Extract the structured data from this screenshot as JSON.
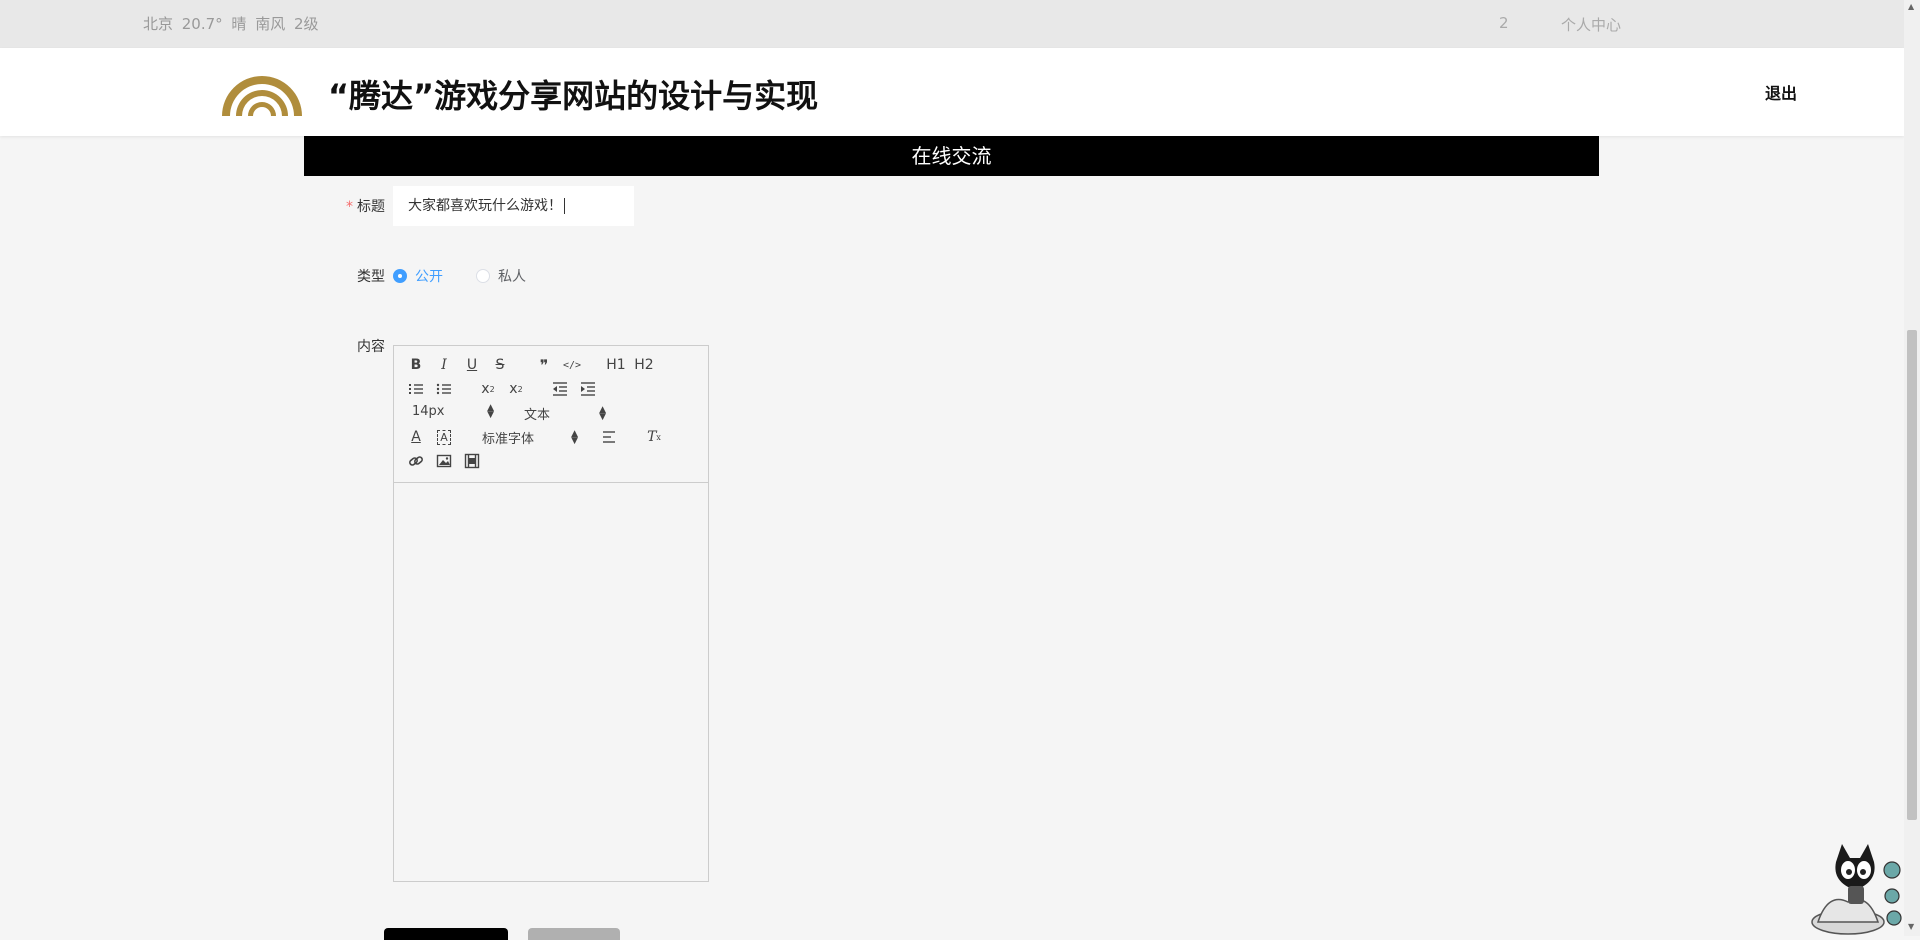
{
  "topbar": {
    "weather": "北京  20.7°  晴  南风  2级",
    "count": "2",
    "user_center": "个人中心"
  },
  "header": {
    "title": "“腾达”游戏分享网站的设计与实现",
    "logout": "退出"
  },
  "banner": {
    "title": "在线交流"
  },
  "form": {
    "title_label": "标题",
    "title_value": "大家都喜欢玩什么游戏！",
    "type_label": "类型",
    "type_options": [
      {
        "label": "公开",
        "checked": true
      },
      {
        "label": "私人",
        "checked": false
      }
    ],
    "content_label": "内容"
  },
  "editor": {
    "font_size": "14px",
    "header_select": "文本",
    "font_family": "标准字体",
    "tools_row1": [
      "B",
      "I",
      "U",
      "S",
      "❞",
      "</>",
      "H1",
      "H2"
    ]
  },
  "colors": {
    "accent": "#409eff",
    "required": "#f56c6c",
    "logo_gold": "#b08d3c"
  }
}
